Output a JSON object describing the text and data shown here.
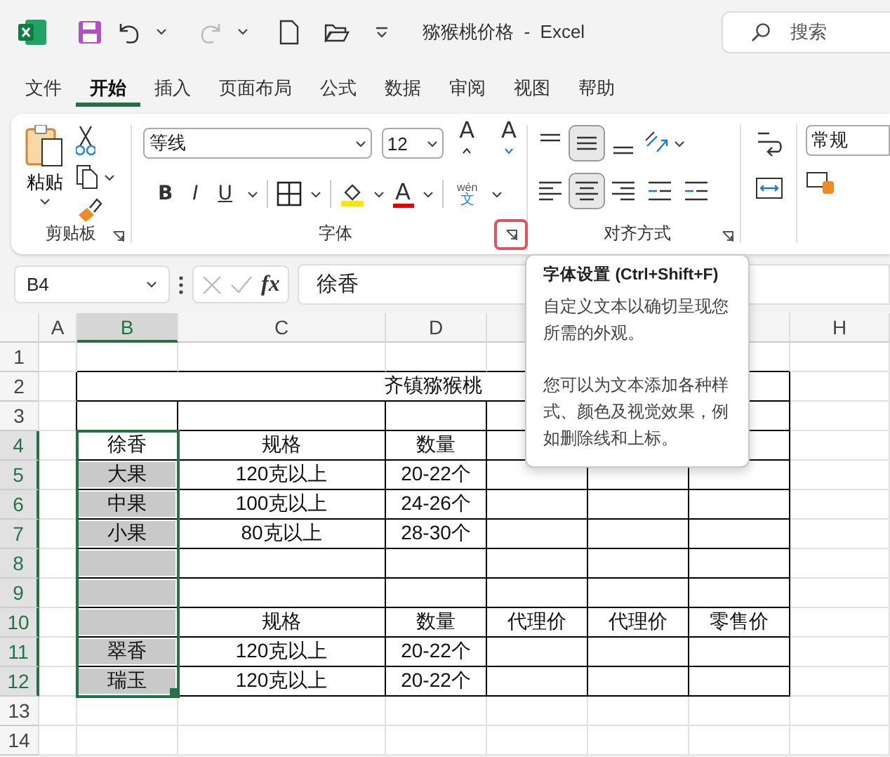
{
  "title_bar": {
    "title": "猕猴桃价格  -  Excel",
    "search_placeholder": "搜索"
  },
  "tabs": [
    {
      "label": "文件",
      "selected": false
    },
    {
      "label": "开始",
      "selected": true
    },
    {
      "label": "插入",
      "selected": false
    },
    {
      "label": "页面布局",
      "selected": false
    },
    {
      "label": "公式",
      "selected": false
    },
    {
      "label": "数据",
      "selected": false
    },
    {
      "label": "审阅",
      "selected": false
    },
    {
      "label": "视图",
      "selected": false
    },
    {
      "label": "帮助",
      "selected": false
    }
  ],
  "ribbon": {
    "clipboard": {
      "paste_label": "粘贴",
      "group_label": "剪贴板"
    },
    "font": {
      "font_name": "等线",
      "font_size": "12",
      "grow_glyph": "A",
      "shrink_glyph": "A",
      "bold_glyph": "B",
      "italic_glyph": "I",
      "underline_glyph": "U",
      "font_color_glyph": "A",
      "phonetic_top": "wén",
      "phonetic_bottom": "文",
      "group_label": "字体",
      "launcher_highlighted": true
    },
    "alignment": {
      "group_label": "对齐方式",
      "middle_align_selected": true,
      "center_selected": true
    },
    "number": {
      "format": "常规"
    }
  },
  "formula_bar": {
    "name_box": "B4",
    "fx": "fx",
    "value": "徐香"
  },
  "grid": {
    "columns": [
      {
        "label": "A",
        "selected": false
      },
      {
        "label": "B",
        "selected": true
      },
      {
        "label": "C",
        "selected": false
      },
      {
        "label": "D",
        "selected": false
      },
      null,
      null,
      null,
      {
        "label": "H",
        "selected": false
      }
    ],
    "rows": [
      {
        "label": "1",
        "selected": false
      },
      {
        "label": "2",
        "selected": false,
        "title": "齐镇猕猴桃"
      },
      {
        "label": "3",
        "selected": false
      },
      {
        "label": "4",
        "selected": true,
        "cells": [
          {
            "text": "徐香",
            "shaded": false
          },
          {
            "text": "规格",
            "shaded": false
          },
          {
            "text": "数量",
            "shaded": false
          }
        ]
      },
      {
        "label": "5",
        "selected": true,
        "cells": [
          {
            "text": "大果",
            "shaded": true
          },
          {
            "text": "120克以上",
            "shaded": false
          },
          {
            "text": "20-22个",
            "shaded": false
          }
        ]
      },
      {
        "label": "6",
        "selected": true,
        "cells": [
          {
            "text": "中果",
            "shaded": true
          },
          {
            "text": "100克以上",
            "shaded": false
          },
          {
            "text": "24-26个",
            "shaded": false
          }
        ]
      },
      {
        "label": "7",
        "selected": true,
        "cells": [
          {
            "text": "小果",
            "shaded": true
          },
          {
            "text": "80克以上",
            "shaded": false
          },
          {
            "text": "28-30个",
            "shaded": false
          }
        ]
      },
      {
        "label": "8",
        "selected": true,
        "cells": [
          {
            "shaded": true
          }
        ]
      },
      {
        "label": "9",
        "selected": true,
        "cells": [
          {
            "shaded": true
          }
        ]
      },
      {
        "label": "10",
        "selected": true,
        "cells": [
          {
            "shaded": true
          },
          {
            "text": "规格",
            "shaded": false
          },
          {
            "text": "数量",
            "shaded": false
          },
          {
            "text": "代理价",
            "shaded": false
          },
          {
            "text": "代理价",
            "shaded": false
          },
          {
            "text": "零售价",
            "shaded": false
          }
        ]
      },
      {
        "label": "11",
        "selected": true,
        "cells": [
          {
            "text": "翠香",
            "shaded": true
          },
          {
            "text": "120克以上",
            "shaded": false
          },
          {
            "text": "20-22个",
            "shaded": false
          }
        ]
      },
      {
        "label": "12",
        "selected": true,
        "cells": [
          {
            "text": "瑞玉",
            "shaded": true
          },
          {
            "text": "120克以上",
            "shaded": false
          },
          {
            "text": "20-22个",
            "shaded": false
          }
        ]
      },
      {
        "label": "13",
        "selected": false
      },
      {
        "label": "14",
        "selected": false
      }
    ]
  },
  "tooltip": {
    "title": "字体设置 (Ctrl+Shift+F)",
    "paragraphs": [
      "自定义文本以确切呈现您所需的外观。",
      "您可以为文本添加各种样式、颜色及视觉效果，例如删除线和上标。"
    ]
  }
}
